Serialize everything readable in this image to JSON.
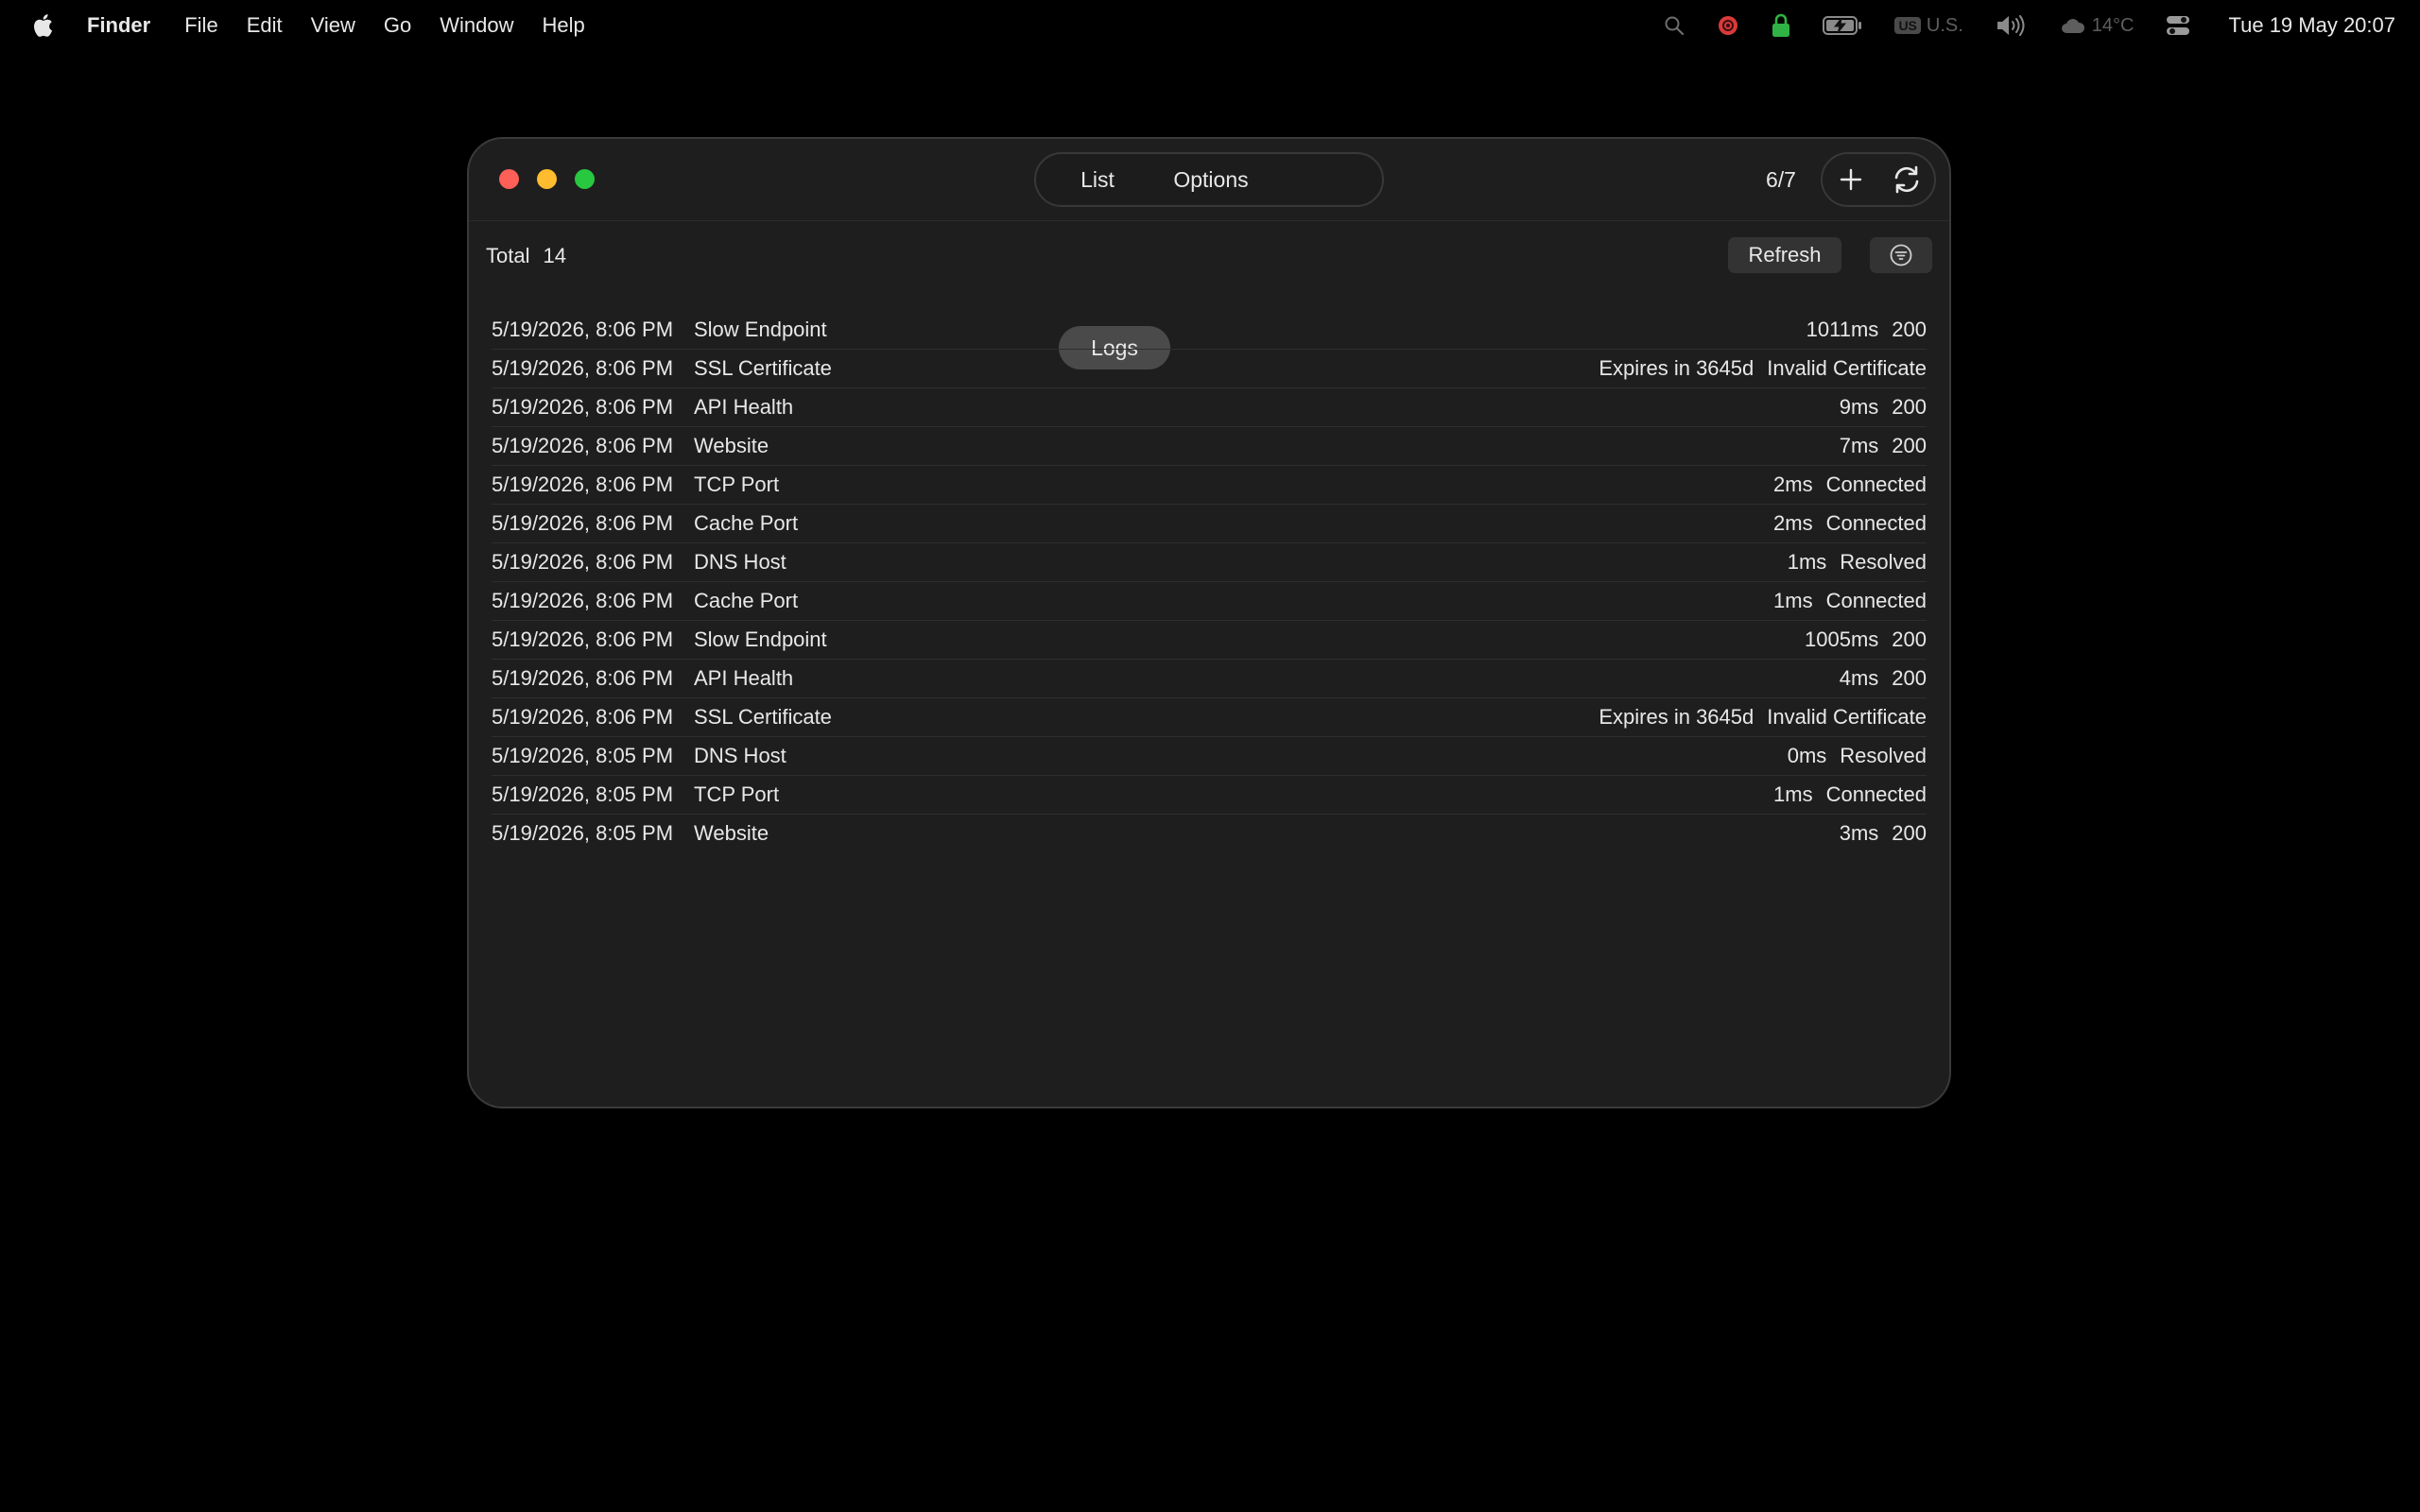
{
  "menubar": {
    "app_name": "Finder",
    "menus": [
      "File",
      "Edit",
      "View",
      "Go",
      "Window",
      "Help"
    ],
    "keyboard_badge": "US",
    "keyboard_label": "U.S.",
    "weather": "14°C",
    "clock": "Tue 19 May  20:07"
  },
  "toolbar": {
    "tabs": [
      "List",
      "Logs",
      "Options"
    ],
    "selected_tab": "Logs",
    "counter": "6/7"
  },
  "summary": {
    "total_label": "Total",
    "total_count": "14",
    "refresh_label": "Refresh"
  },
  "logs": [
    {
      "timestamp": "5/19/2026, 8:06 PM",
      "name": "Slow Endpoint",
      "latency": "1011ms",
      "status": "200"
    },
    {
      "timestamp": "5/19/2026, 8:06 PM",
      "name": "SSL Certificate",
      "latency": "Expires in 3645d",
      "status": "Invalid Certificate"
    },
    {
      "timestamp": "5/19/2026, 8:06 PM",
      "name": "API Health",
      "latency": "9ms",
      "status": "200"
    },
    {
      "timestamp": "5/19/2026, 8:06 PM",
      "name": "Website",
      "latency": "7ms",
      "status": "200"
    },
    {
      "timestamp": "5/19/2026, 8:06 PM",
      "name": "TCP Port",
      "latency": "2ms",
      "status": "Connected"
    },
    {
      "timestamp": "5/19/2026, 8:06 PM",
      "name": "Cache Port",
      "latency": "2ms",
      "status": "Connected"
    },
    {
      "timestamp": "5/19/2026, 8:06 PM",
      "name": "DNS Host",
      "latency": "1ms",
      "status": "Resolved"
    },
    {
      "timestamp": "5/19/2026, 8:06 PM",
      "name": "Cache Port",
      "latency": "1ms",
      "status": "Connected"
    },
    {
      "timestamp": "5/19/2026, 8:06 PM",
      "name": "Slow Endpoint",
      "latency": "1005ms",
      "status": "200"
    },
    {
      "timestamp": "5/19/2026, 8:06 PM",
      "name": "API Health",
      "latency": "4ms",
      "status": "200"
    },
    {
      "timestamp": "5/19/2026, 8:06 PM",
      "name": "SSL Certificate",
      "latency": "Expires in 3645d",
      "status": "Invalid Certificate"
    },
    {
      "timestamp": "5/19/2026, 8:05 PM",
      "name": "DNS Host",
      "latency": "0ms",
      "status": "Resolved"
    },
    {
      "timestamp": "5/19/2026, 8:05 PM",
      "name": "TCP Port",
      "latency": "1ms",
      "status": "Connected"
    },
    {
      "timestamp": "5/19/2026, 8:05 PM",
      "name": "Website",
      "latency": "3ms",
      "status": "200"
    }
  ],
  "icons": {
    "apple": "apple-icon",
    "search": "search-icon",
    "shield": "shield-icon",
    "lock": "lock-icon",
    "battery": "battery-charging-icon",
    "volume": "volume-icon",
    "cloud": "cloud-icon",
    "control_center": "control-center-icon",
    "add": "plus-icon",
    "refresh": "sync-icon",
    "filter": "filter-icon"
  },
  "colors": {
    "close": "#fe5f57",
    "minimize": "#febc2e",
    "maximize": "#28c840",
    "shield_red": "#d93a3a",
    "lock_green": "#2fb344"
  }
}
